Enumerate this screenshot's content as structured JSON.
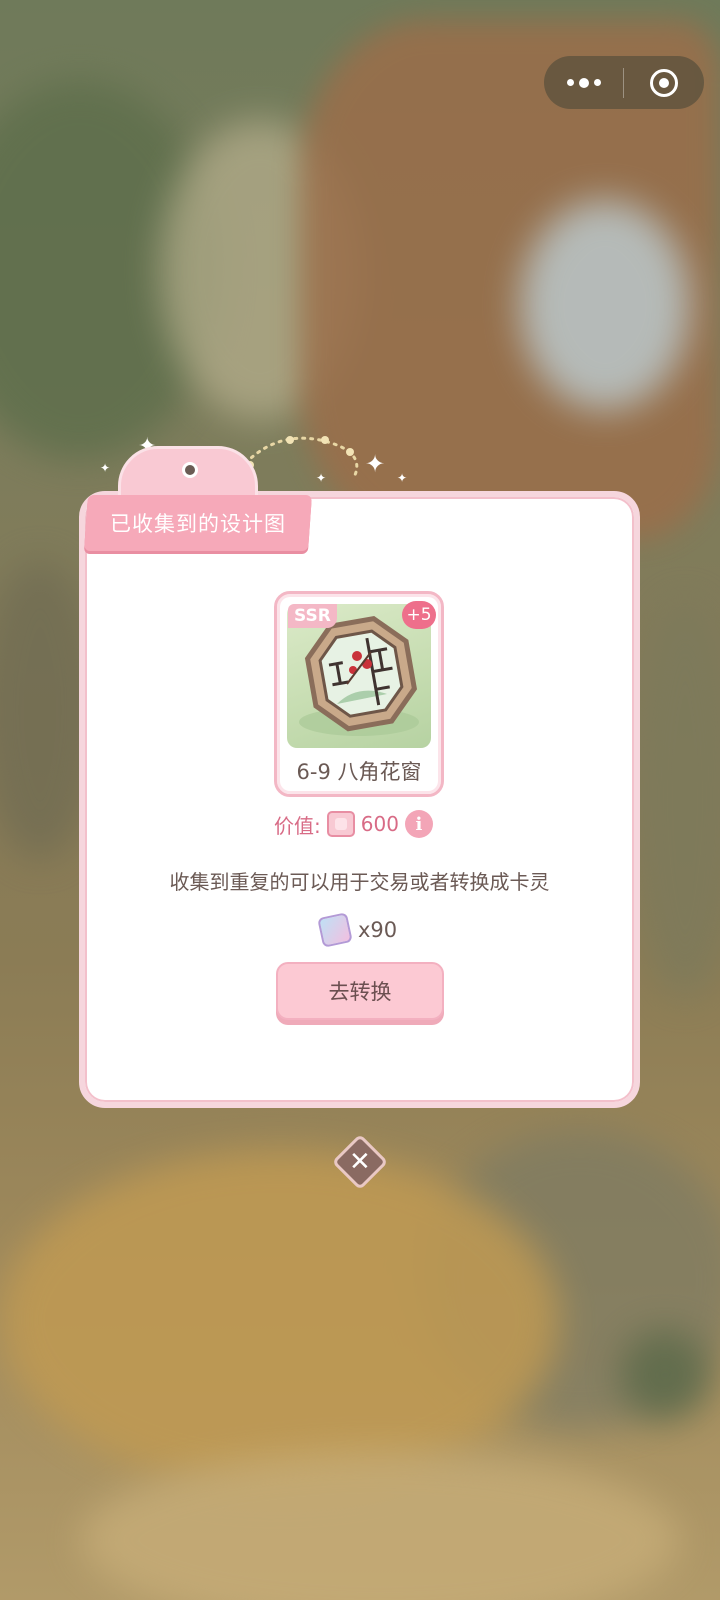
{
  "capsule": {
    "more_icon": "more-dots-icon",
    "close_icon": "target-circle-icon"
  },
  "modal": {
    "tag_title": "已收集到的设计图",
    "item": {
      "rarity": "SSR",
      "bonus": "+5",
      "name": "6-9 八角花窗",
      "image_icon": "octagonal-window-icon"
    },
    "value_label": "价值:",
    "value_amount": "600",
    "value_icon": "card-currency-icon",
    "info_icon": "info-icon",
    "description": "收集到重复的可以用于交易或者转换成卡灵",
    "spirit_count": "x90",
    "spirit_icon": "card-spirit-icon",
    "convert_button": "去转换"
  },
  "close_icon": "close-icon",
  "colors": {
    "accent_pink": "#f6a9b9",
    "text_brown": "#6b5a55",
    "value_pink": "#d86b86",
    "badge_pink": "#ee6f8b"
  }
}
